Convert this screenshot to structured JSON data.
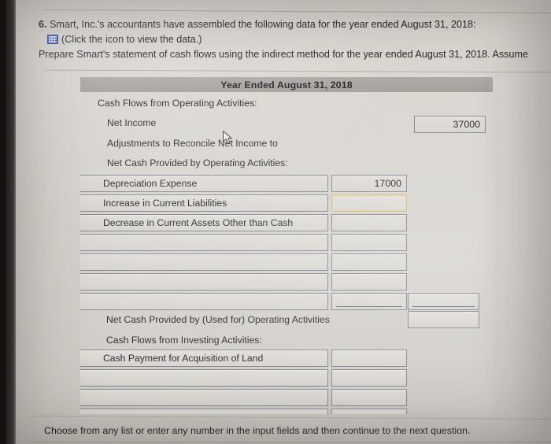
{
  "question": {
    "number": "6.",
    "line1": "Smart, Inc.'s accountants have assembled the following data for the year ended August 31, 2018:",
    "icon_name": "spreadsheet-grid-icon",
    "line2": "(Click the icon to view the data.)",
    "line3": "Prepare Smart's statement of cash flows using the indirect method for the year ended August 31, 2018. Assume"
  },
  "statement": {
    "header": "Year Ended August 31, 2018",
    "sections": [
      {
        "label": "Cash Flows from Operating Activities:"
      },
      {
        "label": "Net Income",
        "amount": "37000"
      },
      {
        "label": "Adjustments to Reconcile Net Income to"
      },
      {
        "label": "Net Cash Provided by Operating Activities:"
      }
    ],
    "operating_rows": [
      {
        "label": "Depreciation Expense",
        "amount": "17000",
        "selected": false,
        "underline": false
      },
      {
        "label": "Increase in Current Liabilities",
        "amount": "",
        "selected": true,
        "underline": false
      },
      {
        "label": "Decrease in Current Assets Other than Cash",
        "amount": "",
        "selected": false,
        "underline": false
      },
      {
        "label": "",
        "amount": "",
        "selected": false,
        "underline": false
      },
      {
        "label": "",
        "amount": "",
        "selected": false,
        "underline": false
      },
      {
        "label": "",
        "amount": "",
        "selected": false,
        "underline": false
      },
      {
        "label": "",
        "amount": "",
        "selected": false,
        "underline": true,
        "subtotal": "",
        "subtotal_underline": true
      }
    ],
    "net_operating": {
      "label": "Net Cash Provided by (Used for) Operating Activities",
      "subtotal": ""
    },
    "investing_header": "Cash Flows from Investing Activities:",
    "investing_rows": [
      {
        "label": "Cash Payment for Acquisition of Land",
        "amount": ""
      },
      {
        "label": "",
        "amount": ""
      },
      {
        "label": "",
        "amount": ""
      },
      {
        "label": "",
        "amount": ""
      }
    ]
  },
  "footer": "Choose from any list or enter any number in the input fields and then continue to the next question.",
  "colors": {
    "header_bar": "#9d9a94",
    "selected_border": "#d9b76a",
    "icon_blue": "#3552c6",
    "page_bg": "#d4d1cb"
  }
}
